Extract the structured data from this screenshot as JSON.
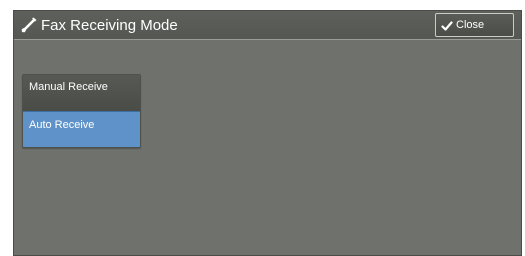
{
  "header": {
    "title": "Fax Receiving Mode",
    "title_icon": "phone-handset-icon",
    "close_label": "Close",
    "close_icon": "checkmark-icon"
  },
  "options": [
    {
      "label": "Manual Receive",
      "selected": false
    },
    {
      "label": "Auto Receive",
      "selected": true
    }
  ],
  "colors": {
    "background": "#6f716c",
    "selected": "#5e92c8",
    "text": "#ffffff"
  }
}
